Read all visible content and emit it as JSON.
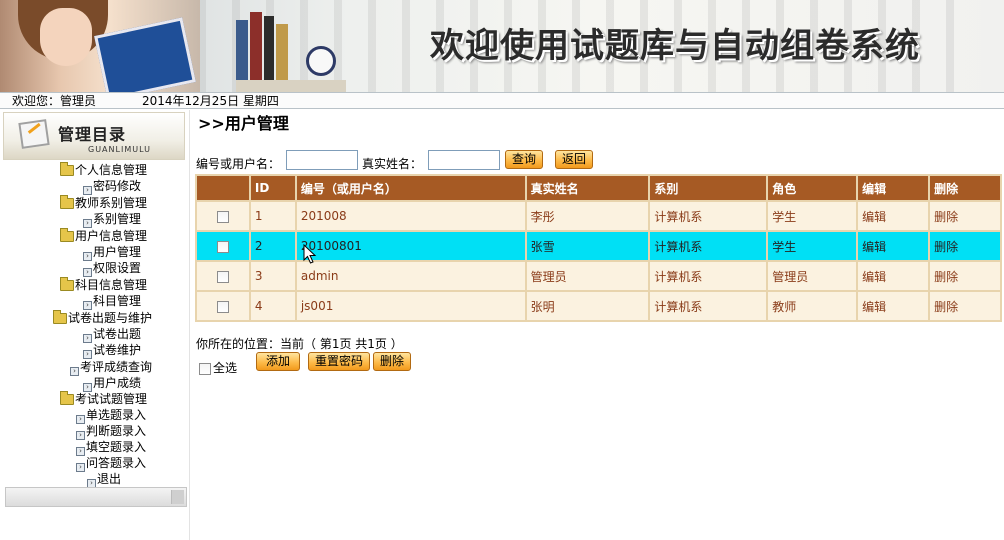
{
  "banner": {
    "title": "欢迎使用试题库与自动组卷系统"
  },
  "status": {
    "welcome": "欢迎您：管理员",
    "date": "2014年12月25日  星期四"
  },
  "sidebar": {
    "title": "管理目录",
    "subtitle": "GUANLIMULU",
    "items": [
      {
        "label": "个人信息管理",
        "icon": "folder-icon"
      },
      {
        "label": "密码修改",
        "icon": "bullet-icon"
      },
      {
        "label": "教师系别管理",
        "icon": "folder-icon"
      },
      {
        "label": "系别管理",
        "icon": "bullet-icon"
      },
      {
        "label": "用户信息管理",
        "icon": "folder-icon"
      },
      {
        "label": "用户管理",
        "icon": "bullet-icon"
      },
      {
        "label": "权限设置",
        "icon": "bullet-icon"
      },
      {
        "label": "科目信息管理",
        "icon": "folder-icon"
      },
      {
        "label": "科目管理",
        "icon": "bullet-icon"
      },
      {
        "label": "试卷出题与维护",
        "icon": "folder-icon"
      },
      {
        "label": "试卷出题",
        "icon": "bullet-icon"
      },
      {
        "label": "试卷维护",
        "icon": "bullet-icon"
      },
      {
        "label": "考评成绩查询",
        "icon": "bullet-icon"
      },
      {
        "label": "用户成绩",
        "icon": "bullet-icon"
      },
      {
        "label": "考试试题管理",
        "icon": "folder-icon"
      },
      {
        "label": "单选题录入",
        "icon": "bullet-icon"
      },
      {
        "label": "判断题录入",
        "icon": "bullet-icon"
      },
      {
        "label": "填空题录入",
        "icon": "bullet-icon"
      },
      {
        "label": "问答题录入",
        "icon": "bullet-icon"
      },
      {
        "label": "退出",
        "icon": "bullet-icon"
      }
    ]
  },
  "main": {
    "page_title": ">>用户管理",
    "search": {
      "id_label": "编号或用户名：",
      "id_value": "",
      "name_label": "真实姓名：",
      "name_value": "",
      "query_button": "查询",
      "back_button": "返回"
    },
    "table": {
      "headers": [
        "",
        "ID",
        "编号（或用户名）",
        "真实姓名",
        "系别",
        "角色",
        "编辑",
        "删除"
      ],
      "rows": [
        {
          "id": "1",
          "username": "201008",
          "name": "李彤",
          "dept": "计算机系",
          "role": "学生",
          "edit": "编辑",
          "del": "删除",
          "selected": false
        },
        {
          "id": "2",
          "username": "20100801",
          "name": "张雪",
          "dept": "计算机系",
          "role": "学生",
          "edit": "编辑",
          "del": "删除",
          "selected": true
        },
        {
          "id": "3",
          "username": "admin",
          "name": "管理员",
          "dept": "计算机系",
          "role": "管理员",
          "edit": "编辑",
          "del": "删除",
          "selected": false
        },
        {
          "id": "4",
          "username": "js001",
          "name": "张明",
          "dept": "计算机系",
          "role": "教师",
          "edit": "编辑",
          "del": "删除",
          "selected": false
        }
      ]
    },
    "position_text": "你所在的位置：当前（ 第1页  共1页 ）",
    "select_all_label": "全选",
    "buttons": {
      "add": "添加",
      "reset_password": "重置密码",
      "delete": "删除"
    }
  },
  "colors": {
    "header_brown": "#a65a24",
    "row_bg": "#fbf2e0",
    "selected_row": "#00e0f5",
    "link_text": "#8a3b18",
    "button_orange": "#fdbb4a"
  }
}
